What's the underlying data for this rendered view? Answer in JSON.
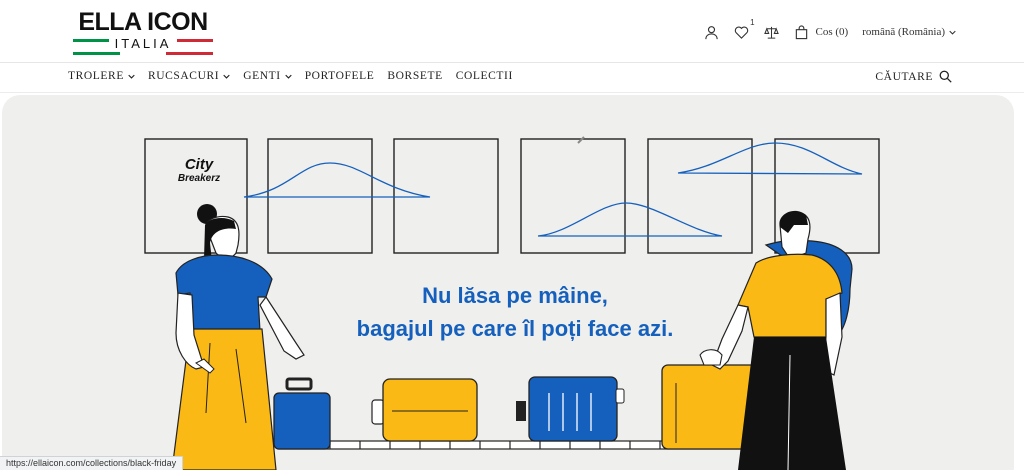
{
  "brand": {
    "logo_main": "ELLA ICON",
    "logo_sub": "ITALIA",
    "colors": {
      "green": "#009246",
      "white": "#ffffff",
      "red": "#ce2b37"
    }
  },
  "header": {
    "account_icon": "user-icon",
    "wishlist_icon": "heart-icon",
    "wishlist_count": "1",
    "compare_icon": "scale-icon",
    "cart_icon": "shopping-bag-icon",
    "cart_label": "Cos (0)",
    "language": "română (România)"
  },
  "nav": {
    "items": [
      {
        "label": "TROLERE",
        "dropdown": true
      },
      {
        "label": "RUCSACURI",
        "dropdown": true
      },
      {
        "label": "GENTI",
        "dropdown": true
      },
      {
        "label": "PORTOFELE",
        "dropdown": false
      },
      {
        "label": "BORSETE",
        "dropdown": false
      },
      {
        "label": "COLECTII",
        "dropdown": false
      }
    ],
    "search_label": "CĂUTARE"
  },
  "hero": {
    "headline_line1": "Nu lăsa pe mâine,",
    "headline_line2": "bagajul pe care îl poți face azi.",
    "sign_line1": "City",
    "sign_line2": "Breakerz",
    "colors": {
      "blue": "#1560bd",
      "yellow": "#fbb915",
      "black": "#111111",
      "bg": "#efefee"
    }
  },
  "status_bar": {
    "url": "https://ellaicon.com/collections/black-friday"
  }
}
